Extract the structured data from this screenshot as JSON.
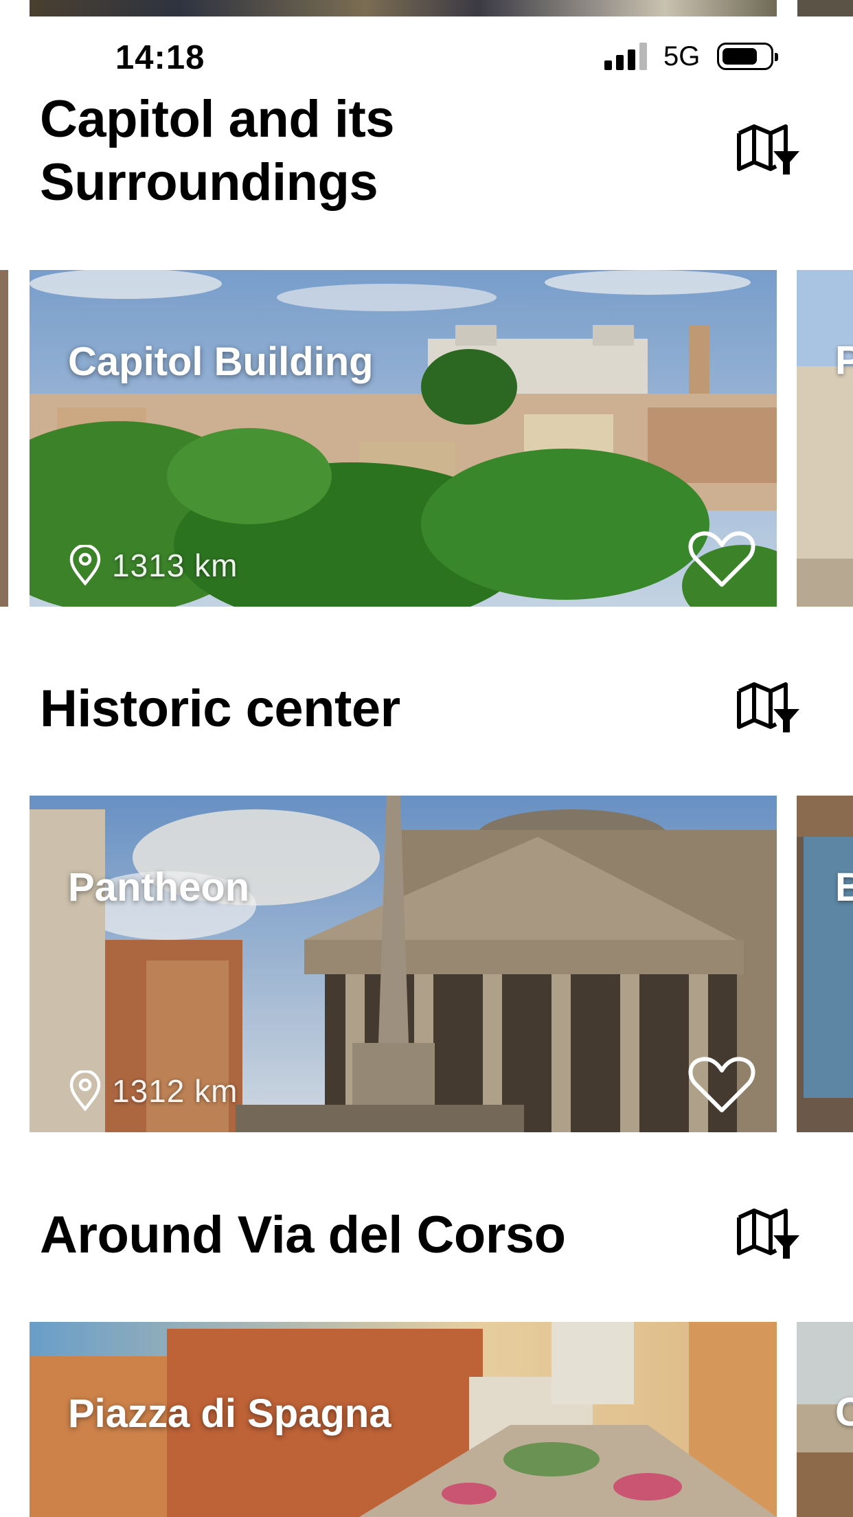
{
  "status_bar": {
    "time": "14:18",
    "network": "5G",
    "signal_bars_active": 3,
    "signal_bars_total": 4,
    "battery_level": 0.7
  },
  "sections": [
    {
      "title": "Capitol and its Surroundings",
      "map_icon": "map-filter-icon",
      "card": {
        "title": "Capitol Building",
        "distance": "1313 km",
        "favorite": false
      },
      "next_card_peek": "P"
    },
    {
      "title": "Historic center",
      "map_icon": "map-filter-icon",
      "card": {
        "title": "Pantheon",
        "distance": "1312 km",
        "favorite": false
      },
      "next_card_peek": "B"
    },
    {
      "title": "Around Via del Corso",
      "map_icon": "map-filter-icon",
      "card": {
        "title": "Piazza di Spagna",
        "distance": "",
        "favorite": false
      },
      "next_card_peek": "C"
    }
  ],
  "icons": {
    "location": "location-pin-icon",
    "favorite": "heart-outline-icon",
    "map": "map-filter-icon"
  }
}
